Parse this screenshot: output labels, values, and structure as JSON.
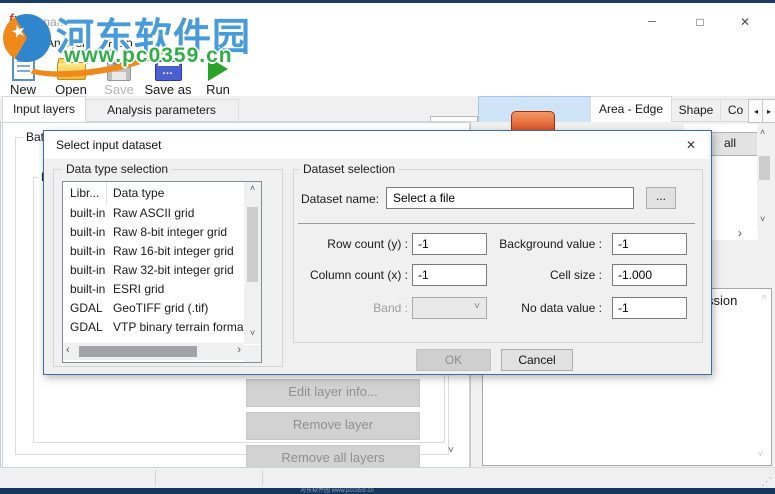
{
  "window": {
    "title": "unnamed1",
    "app_icon": "fx",
    "controls": {
      "minimize": "─",
      "maximize": "□",
      "close": "✕"
    }
  },
  "watermark": {
    "site_name": "河东软件园",
    "site_url": "www.pc0359.cn",
    "footer_text": "河东软件园 www.pc0359.cn",
    "logo_star": "★"
  },
  "menu_items": [
    "File",
    "Analysis",
    "Help"
  ],
  "toolbar": [
    {
      "label": "New"
    },
    {
      "label": "Open"
    },
    {
      "label": "Save"
    },
    {
      "label": "Save as"
    },
    {
      "label": "Run"
    }
  ],
  "left_tabs": [
    "Input layers",
    "Analysis parameters"
  ],
  "right_tabs": [
    "Area - Edge",
    "Shape",
    "Co"
  ],
  "left_panel": {
    "group_label": "Bat",
    "subgroup_label": "L",
    "buttons": [
      "Edit layer info...",
      "Remove layer",
      "Remove all layers"
    ]
  },
  "right_panel": {
    "all_button_label": "all",
    "expression_label": "Expression"
  },
  "dialog": {
    "title": "Select input dataset",
    "data_type_group": {
      "label": "Data type selection",
      "columns": [
        "Libr...",
        "Data type"
      ],
      "rows": [
        {
          "lib": "built-in",
          "type": "Raw ASCII grid"
        },
        {
          "lib": "built-in",
          "type": "Raw 8-bit integer grid"
        },
        {
          "lib": "built-in",
          "type": "Raw 16-bit integer grid"
        },
        {
          "lib": "built-in",
          "type": "Raw 32-bit integer grid"
        },
        {
          "lib": "built-in",
          "type": "ESRI grid"
        },
        {
          "lib": "GDAL",
          "type": "GeoTIFF grid (.tif)"
        },
        {
          "lib": "GDAL",
          "type": "VTP binary terrain format"
        }
      ]
    },
    "dataset_group": {
      "label": "Dataset selection",
      "name_label": "Dataset name:",
      "name_value": "Select a file",
      "browse_label": "...",
      "fields": {
        "row_count": {
          "label": "Row count (y) :",
          "value": "-1"
        },
        "background": {
          "label": "Background value :",
          "value": "-1"
        },
        "column_count": {
          "label": "Column count (x) :",
          "value": "-1"
        },
        "cell_size": {
          "label": "Cell size :",
          "value": "-1.000"
        },
        "band": {
          "label": "Band :",
          "value": ""
        },
        "no_data": {
          "label": "No data value :",
          "value": "-1"
        }
      }
    },
    "ok_label": "OK",
    "cancel_label": "Cancel"
  },
  "glyphs": {
    "up": "˄",
    "down": "˅",
    "left": "‹",
    "right": "›",
    "tab_left": "◂",
    "tab_right": "▸",
    "grip": "⋰",
    "dots": "…",
    "dropdown": "˅"
  },
  "colors": {
    "dialog_border": "#3a6ea5",
    "watermark_blue": "#479bd8",
    "watermark_green": "#2fae47",
    "run_green": "#27a427",
    "selection_blue": "#cfe4f7",
    "orange_button": "#d0451f"
  }
}
